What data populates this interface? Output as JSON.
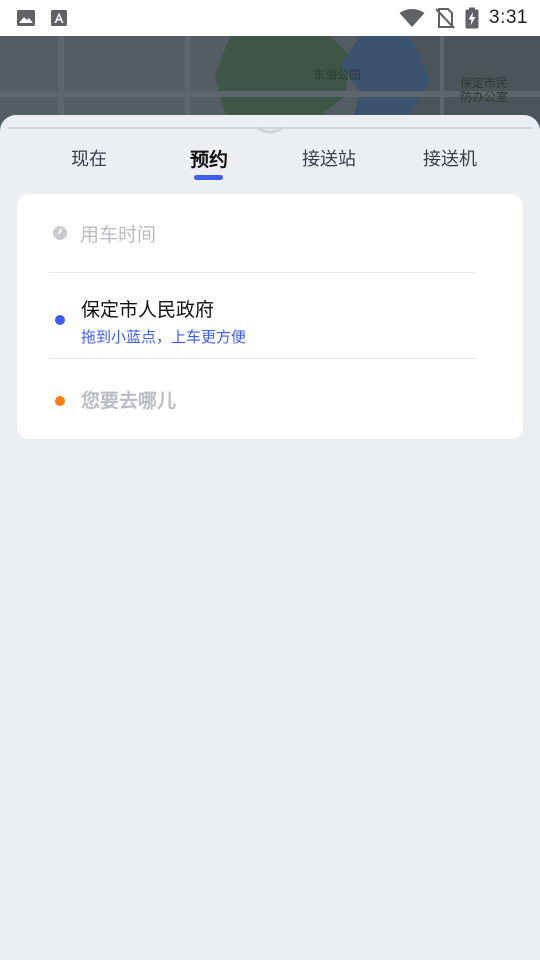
{
  "status_bar": {
    "time": "3:31",
    "icons": [
      "image-icon",
      "text-a-icon",
      "wifi-icon",
      "no-sim-icon",
      "battery-charging-icon"
    ]
  },
  "map": {
    "labels": {
      "park": "东湖公园",
      "office_line1": "保定市民",
      "office_line2": "防办公室"
    }
  },
  "tabs": {
    "now": "现在",
    "reserve": "预约",
    "station": "接送站",
    "airport": "接送机",
    "active": "预约"
  },
  "booking": {
    "time_placeholder": "用车时间",
    "origin_title": "保定市人民政府",
    "origin_hint": "拖到小蓝点，上车更方便",
    "destination_placeholder": "您要去哪儿"
  },
  "colors": {
    "accent_blue": "#3d5cf0",
    "destination_orange": "#fb7d10",
    "background": "#ebeef3"
  }
}
